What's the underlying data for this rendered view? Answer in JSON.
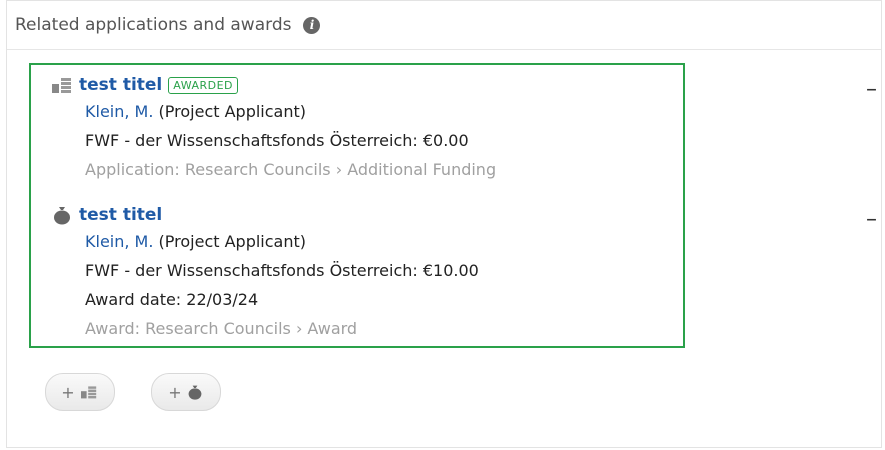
{
  "panel": {
    "title": "Related applications and awards",
    "info_icon": "info-icon"
  },
  "items": [
    {
      "icon": "application-icon",
      "title": "test titel",
      "badge": "AWARDED",
      "person_name": "Klein, M.",
      "person_role": "(Project Applicant)",
      "funding": "FWF - der Wissenschaftsfonds Österreich: €0.00",
      "category": "Application: Research Councils › Additional Funding",
      "collapse_label": "–"
    },
    {
      "icon": "money-bag-icon",
      "title": "test titel",
      "person_name": "Klein, M.",
      "person_role": "(Project Applicant)",
      "funding": "FWF - der Wissenschaftsfonds Österreich: €10.00",
      "award_date": "Award date: 22/03/24",
      "category": "Award: Research Councils › Award",
      "collapse_label": "–"
    }
  ],
  "actions": {
    "add_application_icon": "add-application-icon",
    "add_award_icon": "add-award-icon",
    "plus": "+"
  },
  "colors": {
    "accent_green": "#2aa14a",
    "link_blue": "#1f5aa6",
    "muted_gray": "#a0a0a0"
  }
}
